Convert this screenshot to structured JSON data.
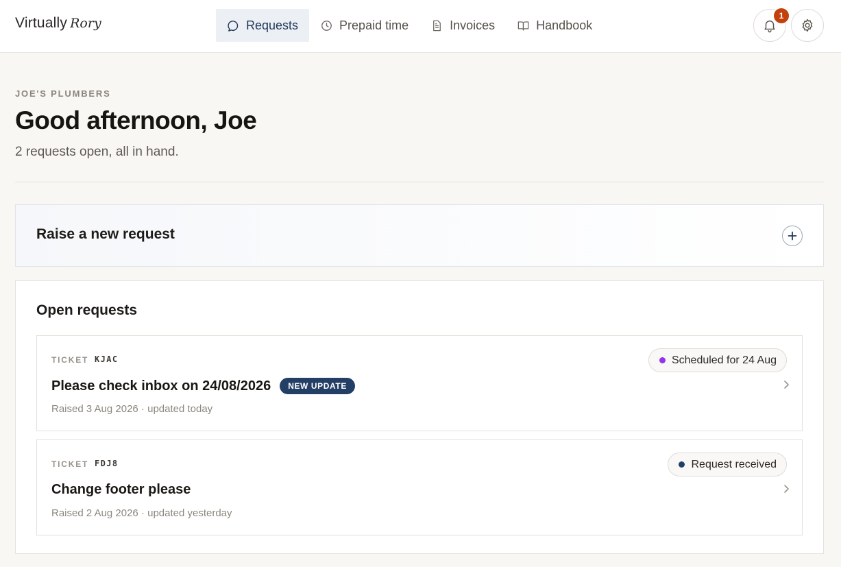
{
  "header": {
    "logo_main": "Virtually",
    "logo_script": "Rory",
    "nav": [
      {
        "label": "Requests",
        "icon": "chat-bubble-icon",
        "active": true
      },
      {
        "label": "Prepaid time",
        "icon": "clock-icon",
        "active": false
      },
      {
        "label": "Invoices",
        "icon": "document-icon",
        "active": false
      },
      {
        "label": "Handbook",
        "icon": "book-icon",
        "active": false
      }
    ],
    "notifications_count": "1",
    "accent_color": "#223a5c",
    "badge_color": "#c2410c"
  },
  "page": {
    "company": "JOE'S PLUMBERS",
    "greeting": "Good afternoon, Joe",
    "summary": "2 requests open, all in hand."
  },
  "raise": {
    "title": "Raise a new request",
    "button_icon": "plus-icon"
  },
  "open_requests": {
    "title": "Open requests",
    "tickets": [
      {
        "label": "TICKET",
        "code": "KJAC",
        "title": "Please check inbox on 24/08/2026",
        "pill": "NEW UPDATE",
        "meta": "Raised 3 Aug 2026 · updated today",
        "status": "Scheduled for 24 Aug",
        "status_color": "#9333ea"
      },
      {
        "label": "TICKET",
        "code": "FDJ8",
        "title": "Change footer please",
        "pill": "",
        "meta": "Raised 2 Aug 2026 · updated yesterday",
        "status": "Request received",
        "status_color": "#243f66"
      }
    ]
  }
}
